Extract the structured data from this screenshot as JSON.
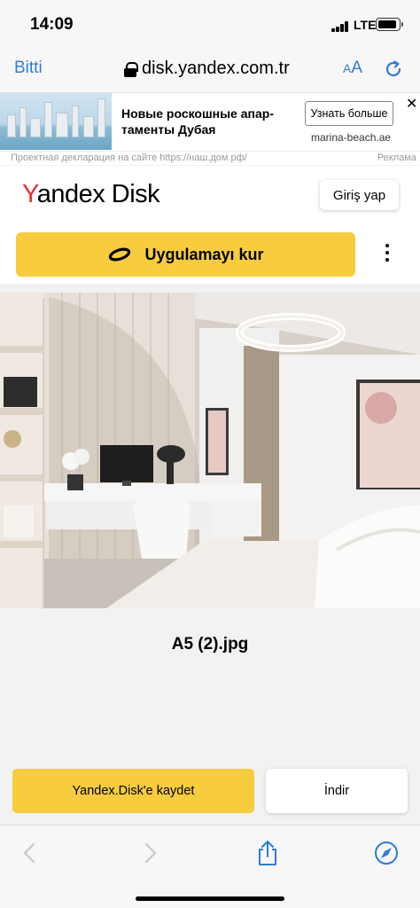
{
  "status_bar": {
    "time": "14:09",
    "network": "LTE"
  },
  "browser": {
    "done_label": "Bitti",
    "url": "disk.yandex.com.tr",
    "text_size_label": "AA",
    "reload_icon": "reload-icon",
    "toolbar": [
      "back-icon",
      "forward-icon",
      "share-icon",
      "compass-icon"
    ]
  },
  "ad": {
    "title": "Новые роскошные апар-таменты Дубая",
    "cta": "Узнать больше",
    "domain": "marina-beach.ae",
    "close": "✕",
    "declaration": "Проектная декларация на сайте https://наш.дом.рф/",
    "label": "Реклама"
  },
  "header": {
    "logo_y": "Y",
    "logo_rest": "andex Disk",
    "login_label": "Giriş yap",
    "install_label": "Uygulamayı kur"
  },
  "file": {
    "name": "A5 (2).jpg"
  },
  "actions": {
    "save_label": "Yandex.Disk'e kaydet",
    "download_label": "İndir"
  },
  "colors": {
    "accent_yellow": "#f7cc3f",
    "link_blue": "#2f7bd9",
    "logo_red": "#e8322b"
  }
}
